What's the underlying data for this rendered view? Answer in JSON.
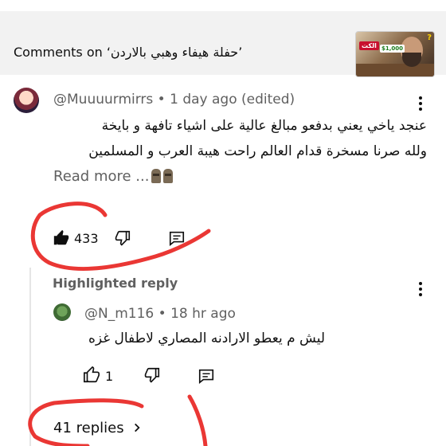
{
  "header": {
    "title": "Comments on ‘حفلة هيفاء وهبي بالاردن’",
    "thumbnail": {
      "badge": "الكت",
      "money": "$1,000"
    }
  },
  "comment": {
    "author": "@Muuuurmirrs",
    "sep": " • ",
    "time": "1 day ago (edited)",
    "line1": "عنجد ياخي يعني بدفعو مبالغ عالية على اشياء تافهة و بايخة",
    "line2": "ولله صرنا مسخرة قدام العالم راحت هيبة العرب و المسلمين",
    "read_more": "Read more ...",
    "likes": "433"
  },
  "highlighted": {
    "label": "Highlighted reply",
    "author": "@N_m116",
    "sep": " • ",
    "time": "18 hr ago",
    "text": "ليش م يعطو الارادنه المصاري لاطفال غزه",
    "likes": "1"
  },
  "replies": {
    "label": "41 replies"
  },
  "colors": {
    "annotation_red": "#e8211e",
    "meta_gray": "#606060",
    "header_bg": "#f2f2f2"
  },
  "icons": [
    "like-icon",
    "dislike-icon",
    "reply-icon",
    "more-vert-icon",
    "chevron-right-icon",
    "moai-emoji"
  ]
}
